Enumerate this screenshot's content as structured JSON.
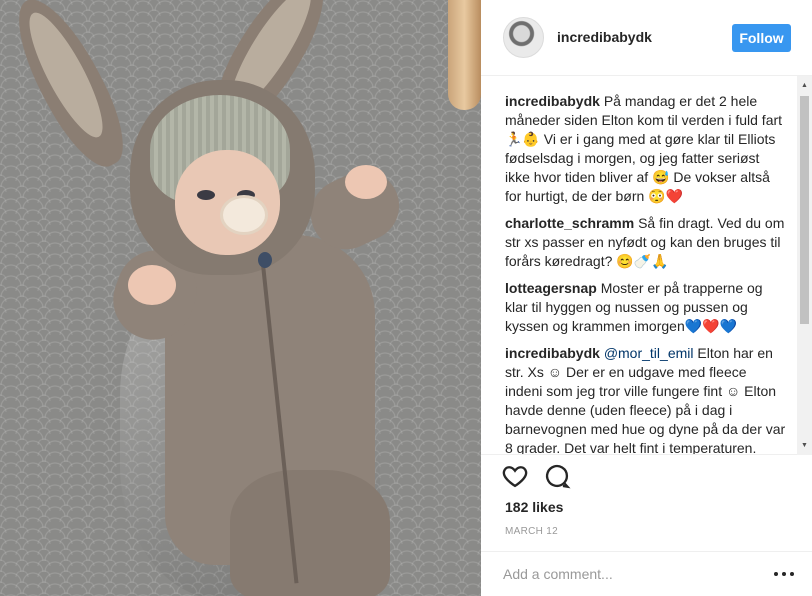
{
  "header": {
    "username": "incredibabydk",
    "follow_label": "Follow"
  },
  "comments": [
    {
      "user": "incredibabydk",
      "text": "På mandag er det 2 hele måneder siden Elton kom til verden i fuld fart 🏃👶 Vi er i gang med at gøre klar til Elliots fødselsdag i morgen, og jeg fatter seriøst ikke hvor tiden bliver af 😅 De vokser altså for hurtigt, de der børn 😳❤️"
    },
    {
      "user": "charlotte_schramm",
      "text": "Så fin dragt. Ved du om str xs passer en nyfødt og kan den bruges til forårs køredragt? 😊🍼🙏"
    },
    {
      "user": "lotteagersnap",
      "text": "Moster er på trapperne og klar til hyggen og nussen og pussen og kyssen og krammen imorgen💙❤️💙"
    },
    {
      "user": "incredibabydk",
      "mention": "@mor_til_emil",
      "text": " Elton har en str. Xs ☺ Der er en udgave med fleece indeni som jeg tror ville fungere fint ☺ Elton havde denne (uden fleece) på i dag i barnevognen med hue og dyne på da der var 8 grader. Det var helt fint i temperaturen. Men vi var ikke på en lang"
    }
  ],
  "actions": {
    "like_icon": "heart-outline-icon",
    "comment_icon": "comment-bubble-icon"
  },
  "likes": "182 likes",
  "date": "MARCH 12",
  "add_comment": {
    "placeholder": "Add a comment..."
  },
  "colors": {
    "follow_button": "#3897f0",
    "text": "#262626",
    "muted": "#999999"
  }
}
